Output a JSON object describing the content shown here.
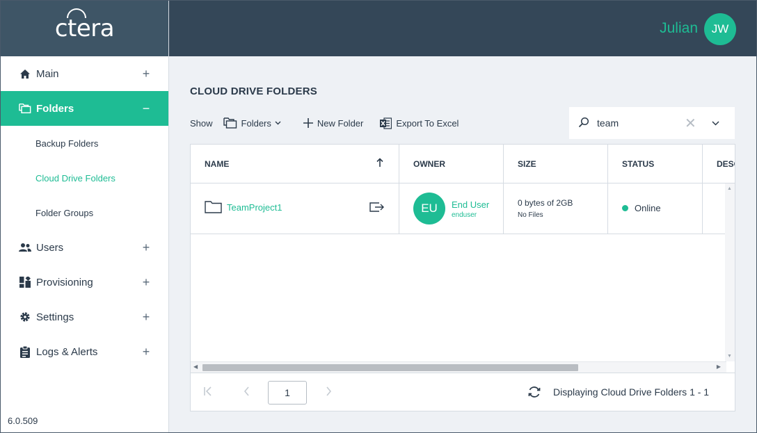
{
  "brand": {
    "logo_text": "ctera"
  },
  "user": {
    "name": "Julian",
    "initials": "JW"
  },
  "nav": {
    "main": "Main",
    "folders": "Folders",
    "sub": {
      "backup": "Backup Folders",
      "cloud": "Cloud Drive Folders",
      "groups": "Folder Groups"
    },
    "users": "Users",
    "provisioning": "Provisioning",
    "settings": "Settings",
    "logs": "Logs & Alerts",
    "expand_symbol": "+",
    "collapse_symbol": "−"
  },
  "version": "6.0.509",
  "page": {
    "title": "CLOUD DRIVE FOLDERS"
  },
  "toolbar": {
    "show_label": "Show",
    "folders_label": "Folders",
    "new_folder": "New Folder",
    "export": "Export To Excel"
  },
  "search": {
    "value": "team",
    "clear": "✕"
  },
  "table": {
    "columns": {
      "name": "NAME",
      "owner": "OWNER",
      "size": "SIZE",
      "status": "STATUS",
      "desc": "DESC"
    },
    "rows": [
      {
        "name": "TeamProject1",
        "owner_initials": "EU",
        "owner_name": "End User",
        "owner_username": "enduser",
        "size": "0 bytes of 2GB",
        "files": "No Files",
        "status": "Online"
      }
    ]
  },
  "pager": {
    "page": "1",
    "info": "Displaying Cloud Drive Folders 1 - 1"
  },
  "colors": {
    "accent": "#1ebc94",
    "topbar": "#344758",
    "logo_bar": "#3e5566"
  }
}
